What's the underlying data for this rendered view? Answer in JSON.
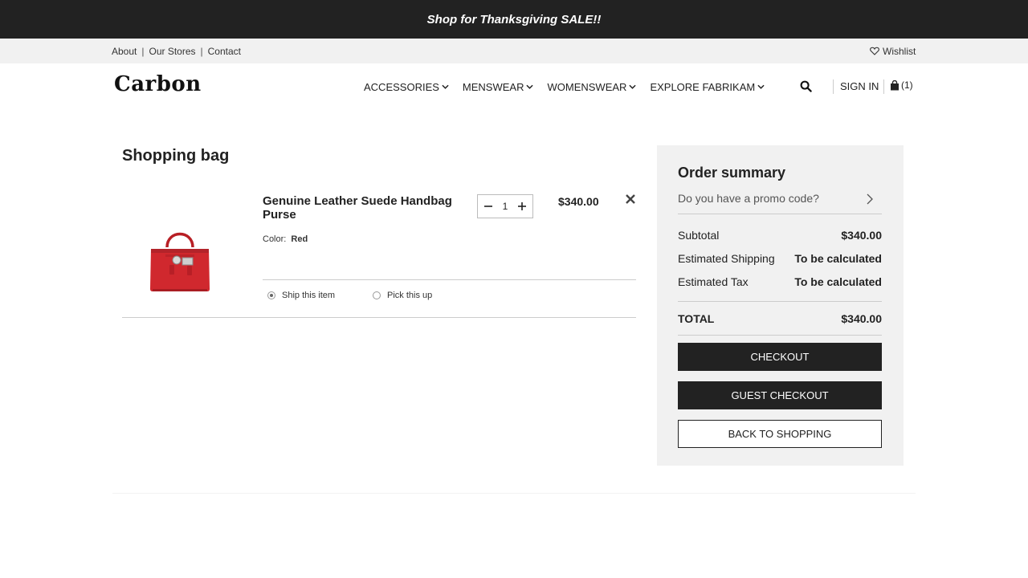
{
  "promo_banner": "Shop for Thanksgiving SALE!!",
  "utility_nav": {
    "links": [
      "About",
      "Our Stores",
      "Contact"
    ],
    "separator": "|",
    "wishlist": "Wishlist"
  },
  "brand": {
    "logo": "Carbon"
  },
  "main_nav": {
    "items": [
      "ACCESSORIES",
      "MENSWEAR",
      "WOMENSWEAR",
      "EXPLORE FABRIKAM"
    ],
    "sign_in": "SIGN IN",
    "bag_count": "(1)"
  },
  "cart": {
    "title": "Shopping bag",
    "item": {
      "name": "Genuine Leather Suede Handbag Purse",
      "color_label": "Color:",
      "color_value": "Red",
      "quantity": "1",
      "price": "$340.00",
      "delivery": {
        "ship": "Ship this item",
        "pickup": "Pick this up",
        "selected": "ship"
      }
    }
  },
  "summary": {
    "title": "Order summary",
    "promo_prompt": "Do you have a promo code?",
    "subtotal_label": "Subtotal",
    "subtotal_value": "$340.00",
    "shipping_label": "Estimated Shipping",
    "shipping_value": "To be calculated",
    "tax_label": "Estimated Tax",
    "tax_value": "To be calculated",
    "total_label": "TOTAL",
    "total_value": "$340.00",
    "checkout": "CHECKOUT",
    "guest_checkout": "GUEST CHECKOUT",
    "back_to_shopping": "BACK TO SHOPPING"
  },
  "icons": {
    "wishlist": "heart-icon",
    "nav_dropdown": "chevron-down-icon",
    "search": "search-icon",
    "bag": "shopping-bag-icon",
    "remove": "close-icon",
    "promo": "chevron-right-icon"
  },
  "colors": {
    "dark": "#222222",
    "panel": "#f1f1f1",
    "product": "#d0282e"
  }
}
